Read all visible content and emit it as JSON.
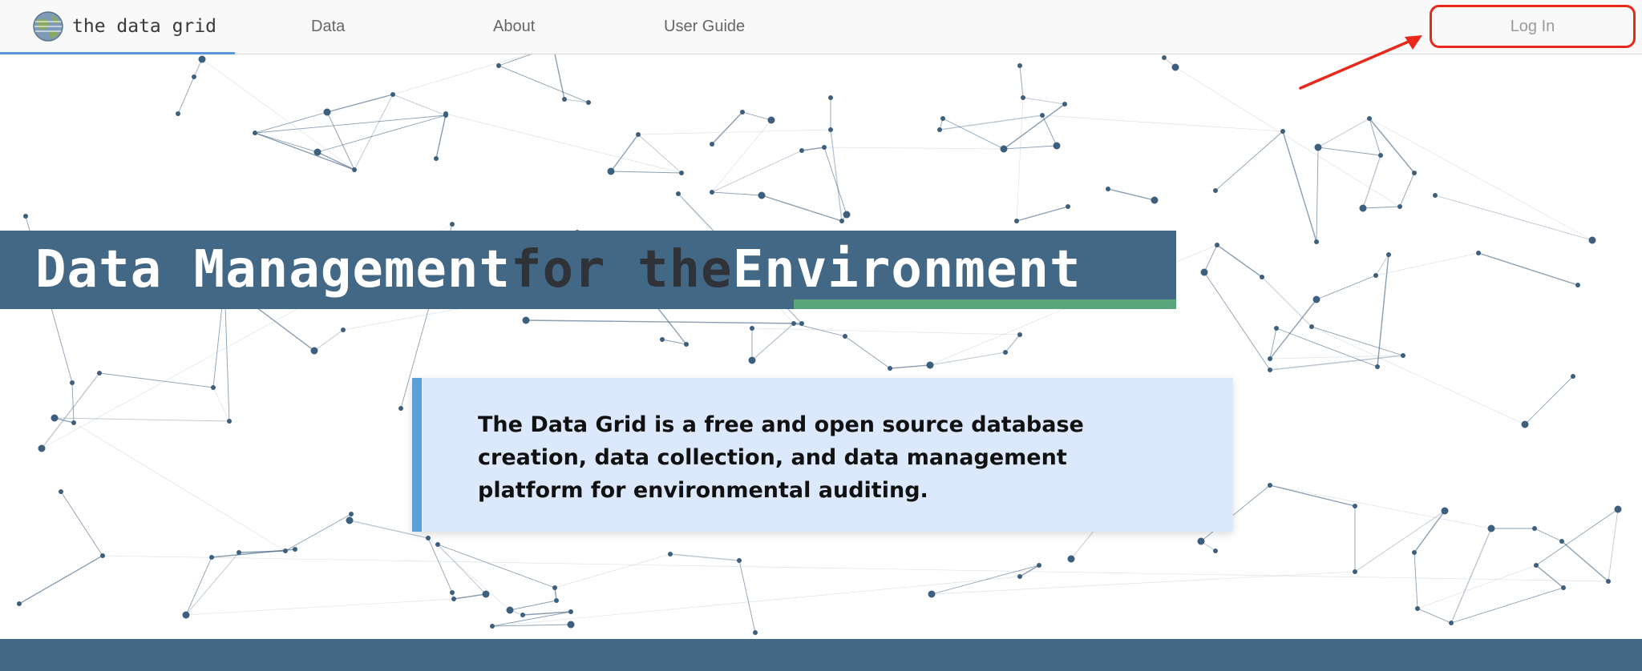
{
  "brand": {
    "name": "the data grid",
    "logo_icon": "globe-icon"
  },
  "nav": {
    "items": [
      {
        "label": "Data"
      },
      {
        "label": "About"
      },
      {
        "label": "User Guide"
      }
    ],
    "login_label": "Log In"
  },
  "hero": {
    "title_part1": "Data Management ",
    "title_part2": "for the ",
    "title_part3": "Environment",
    "description": "The Data Grid is a free and open source database creation, data collection, and data management platform for environmental auditing."
  },
  "colors": {
    "banner": "#436886",
    "accent_green": "#5aa67c",
    "callout_bg": "#dce8fc",
    "callout_border": "#5a9fd8",
    "annotation_red": "#e8281a",
    "network_node": "#3d5f7e"
  }
}
